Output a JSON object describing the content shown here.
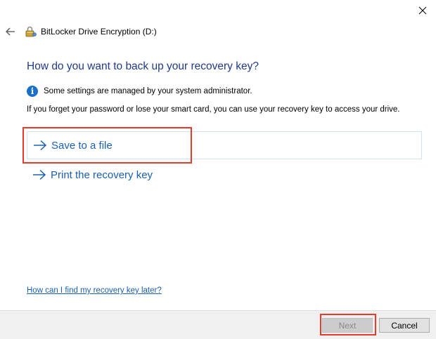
{
  "window": {
    "title": "BitLocker Drive Encryption (D:)"
  },
  "heading": "How do you want to back up your recovery key?",
  "info": {
    "icon": "info-icon",
    "text": "Some settings are managed by your system administrator."
  },
  "description": "If you forget your password or lose your smart card, you can use your recovery key to access your drive.",
  "options": [
    {
      "label": "Save to a file",
      "icon": "arrow-right-icon"
    },
    {
      "label": "Print the recovery key",
      "icon": "arrow-right-icon"
    }
  ],
  "help_link": "How can I find my recovery key later?",
  "footer": {
    "next_label": "Next",
    "cancel_label": "Cancel"
  },
  "colors": {
    "heading": "#1f3b89",
    "link": "#1a5fb0",
    "highlight": "#e83a2a",
    "info": "#1a6fc9"
  }
}
